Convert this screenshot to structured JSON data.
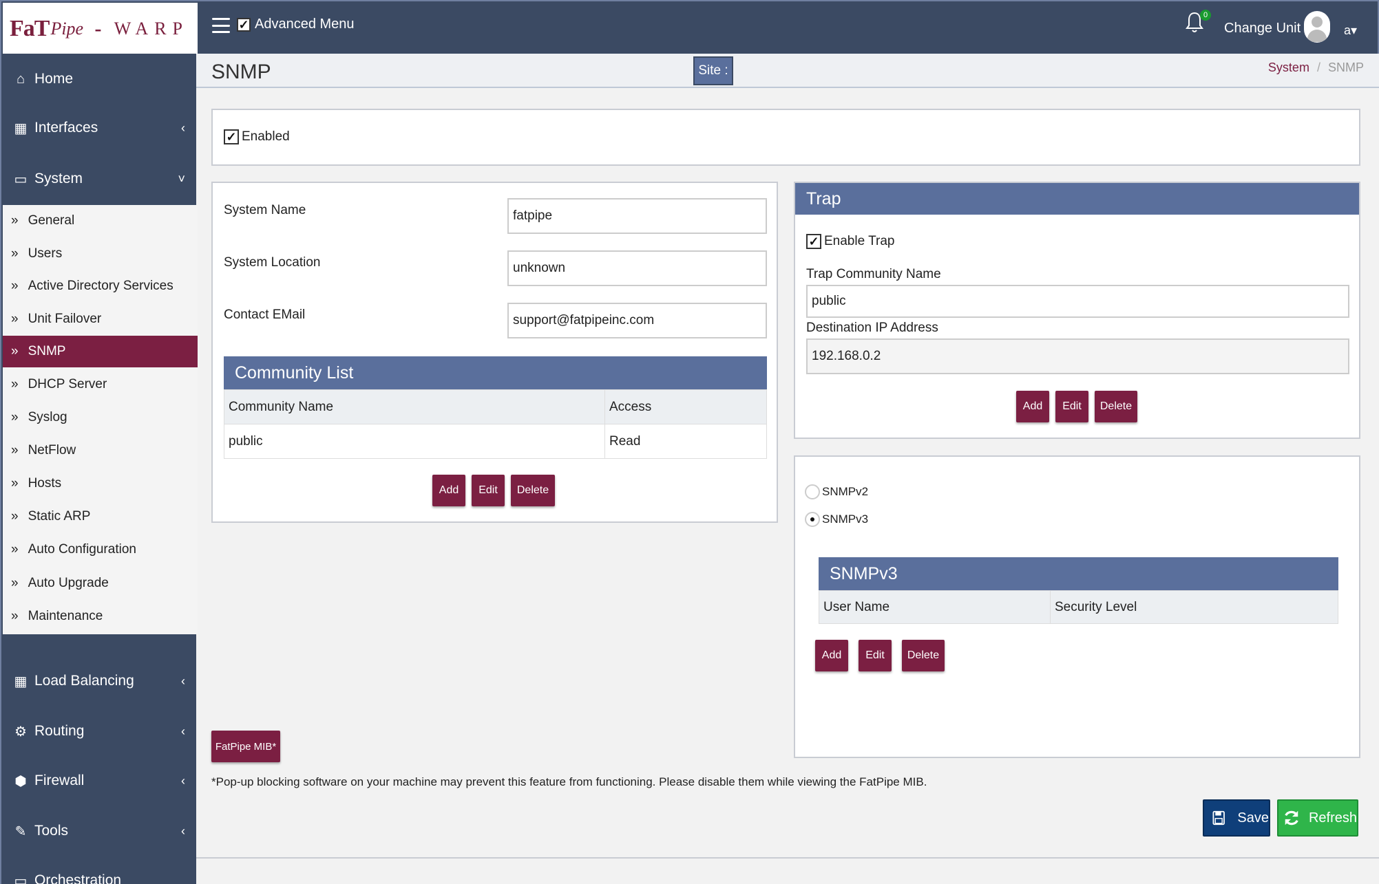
{
  "brand": {
    "fat": "FaT",
    "pipe": "Pipe",
    "dash": "-",
    "warp": "WARP"
  },
  "topbar": {
    "advanced_menu_label": "Advanced Menu",
    "advanced_menu_checked": true,
    "notification_count": "0",
    "change_unit_label": "Change Unit",
    "user_label": "a▾"
  },
  "sidebar": {
    "main_items": [
      {
        "label": "Home",
        "icon": "home-icon"
      },
      {
        "label": "Interfaces",
        "icon": "table-icon",
        "chevron": "‹"
      },
      {
        "label": "System",
        "icon": "laptop-icon",
        "chevron": "˅"
      },
      {
        "label": "Load Balancing",
        "icon": "grid-icon",
        "chevron": "‹"
      },
      {
        "label": "Routing",
        "icon": "gear-icon",
        "chevron": "‹"
      },
      {
        "label": "Firewall",
        "icon": "cube-icon",
        "chevron": "‹"
      },
      {
        "label": "Tools",
        "icon": "edit-icon",
        "chevron": "‹"
      },
      {
        "label": "Orchestration",
        "icon": "desktop-icon"
      }
    ],
    "system_subitems": [
      {
        "label": "General"
      },
      {
        "label": "Users"
      },
      {
        "label": "Active Directory Services"
      },
      {
        "label": "Unit Failover"
      },
      {
        "label": "SNMP",
        "active": true
      },
      {
        "label": "DHCP Server"
      },
      {
        "label": "Syslog"
      },
      {
        "label": "NetFlow"
      },
      {
        "label": "Hosts"
      },
      {
        "label": "Static ARP"
      },
      {
        "label": "Auto Configuration"
      },
      {
        "label": "Auto Upgrade"
      },
      {
        "label": "Maintenance"
      }
    ]
  },
  "page": {
    "title": "SNMP",
    "site_label": "Site :",
    "breadcrumb": {
      "parent": "System",
      "separator": "/",
      "current": "SNMP"
    }
  },
  "enabled": {
    "label": "Enabled",
    "checked": true
  },
  "system_info": {
    "name_label": "System Name",
    "name_value": "fatpipe",
    "location_label": "System Location",
    "location_value": "unknown",
    "email_label": "Contact EMail",
    "email_value": "support@fatpipeinc.com"
  },
  "community_list": {
    "title": "Community List",
    "columns": [
      "Community Name",
      "Access"
    ],
    "rows": [
      [
        "public",
        "Read"
      ]
    ],
    "add_label": "Add",
    "edit_label": "Edit",
    "delete_label": "Delete"
  },
  "trap": {
    "title": "Trap",
    "enable_label": "Enable Trap",
    "enable_checked": true,
    "community_label": "Trap Community Name",
    "community_value": "public",
    "dest_label": "Destination IP Address",
    "dest_value": "192.168.0.2",
    "add_label": "Add",
    "edit_label": "Edit",
    "delete_label": "Delete"
  },
  "version": {
    "options": [
      {
        "label": "SNMPv2",
        "selected": false
      },
      {
        "label": "SNMPv3",
        "selected": true
      }
    ]
  },
  "snmpv3": {
    "title": "SNMPv3",
    "columns": [
      "User Name",
      "Security Level"
    ],
    "add_label": "Add",
    "edit_label": "Edit",
    "delete_label": "Delete"
  },
  "mib": {
    "button_label": "FatPipe MIB*",
    "note": "*Pop-up blocking software on your machine may prevent this feature from functioning. Please disable them while viewing the FatPipe MIB."
  },
  "actions": {
    "save_label": "Save",
    "refresh_label": "Refresh"
  },
  "colors": {
    "navy": "#3b4a63",
    "maroon": "#7b1f42",
    "panel_header": "#5a6f9c",
    "save_blue": "#0f3f7a",
    "refresh_green": "#2fb54a"
  }
}
